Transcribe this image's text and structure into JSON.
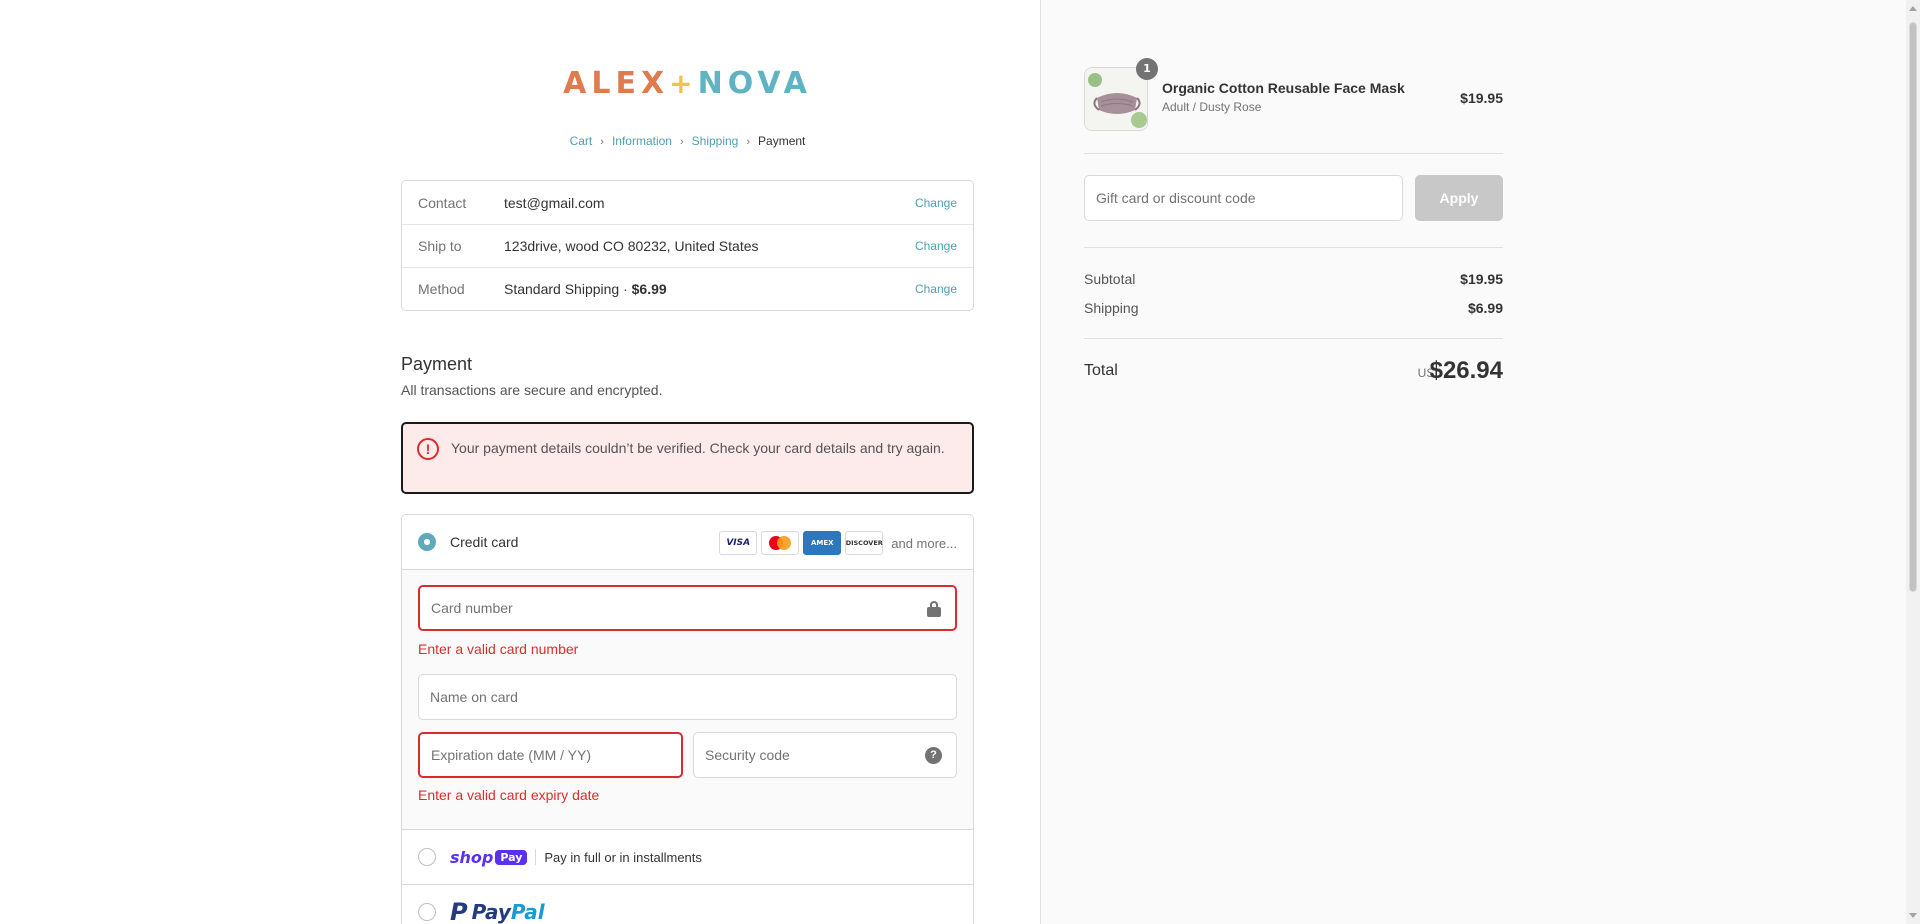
{
  "brand": {
    "part1": "ALEX",
    "plus": "+",
    "part2": "NOVA"
  },
  "breadcrumb": {
    "items": [
      "Cart",
      "Information",
      "Shipping"
    ],
    "current": "Payment",
    "sep": "›"
  },
  "review": {
    "change_label": "Change",
    "rows": [
      {
        "label": "Contact",
        "value": "test@gmail.com"
      },
      {
        "label": "Ship to",
        "value": "123drive, wood CO 80232, United States"
      },
      {
        "label": "Method",
        "value": "Standard Shipping · ",
        "value_bold": "$6.99"
      }
    ]
  },
  "payment": {
    "title": "Payment",
    "subtitle": "All transactions are secure and encrypted.",
    "error_message": "Your payment details couldn’t be verified. Check your card details and try again.",
    "error_icon": "!",
    "credit_card": {
      "label": "Credit card",
      "cards": [
        "VISA",
        "mastercard",
        "AMEX",
        "DISCOVER"
      ],
      "more": "and more...",
      "card_number_placeholder": "Card number",
      "card_number_error": "Enter a valid card number",
      "name_placeholder": "Name on card",
      "expiry_placeholder": "Expiration date (MM / YY)",
      "expiry_error": "Enter a valid card expiry date",
      "security_placeholder": "Security code",
      "help_glyph": "?"
    },
    "shop_pay": {
      "logo_text": "shop",
      "badge": "Pay",
      "text": "Pay in full or in installments"
    },
    "paypal": {
      "icon": "P",
      "pay": "Pay",
      "pal": "Pal"
    }
  },
  "sidebar": {
    "product": {
      "quantity": "1",
      "name": "Organic Cotton Reusable Face Mask",
      "variant": "Adult / Dusty Rose",
      "price": "$19.95"
    },
    "discount_placeholder": "Gift card or discount code",
    "apply_label": "Apply",
    "subtotal_label": "Subtotal",
    "subtotal": "$19.95",
    "shipping_label": "Shipping",
    "shipping": "$6.99",
    "total_label": "Total",
    "currency": "USD",
    "total": "$26.94"
  },
  "colors": {
    "accent": "#4e9fb2",
    "error": "#d92d2d",
    "error_bg": "#fdeaea",
    "shop_pay": "#5a31f4"
  }
}
